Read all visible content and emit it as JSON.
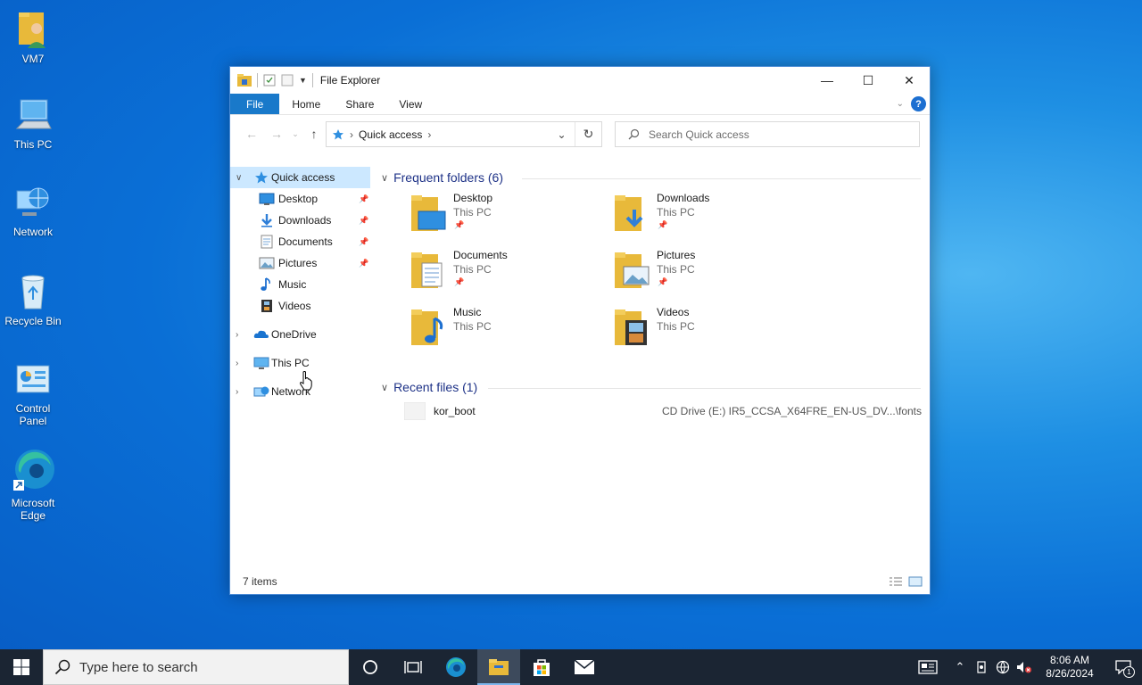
{
  "desktop": {
    "icons": [
      {
        "label": "VM7"
      },
      {
        "label": "This PC"
      },
      {
        "label": "Network"
      },
      {
        "label": "Recycle Bin"
      },
      {
        "label": "Control Panel"
      },
      {
        "label": "Microsoft Edge"
      }
    ]
  },
  "window": {
    "title": "File Explorer",
    "controls": {
      "minimize": "—",
      "maximize": "☐",
      "close": "✕"
    },
    "ribbon": {
      "tabs": [
        "File",
        "Home",
        "Share",
        "View"
      ],
      "help": "?"
    },
    "address": {
      "location": "Quick access"
    },
    "search": {
      "placeholder": "Search Quick access"
    },
    "nav_pane": {
      "quick_access": "Quick access",
      "pinned": [
        {
          "label": "Desktop"
        },
        {
          "label": "Downloads"
        },
        {
          "label": "Documents"
        },
        {
          "label": "Pictures"
        },
        {
          "label": "Music"
        },
        {
          "label": "Videos"
        }
      ],
      "onedrive": "OneDrive",
      "this_pc": "This PC",
      "network": "Network"
    },
    "content": {
      "frequent_header": "Frequent folders (6)",
      "folders": [
        {
          "name": "Desktop",
          "location": "This PC",
          "pinned": true
        },
        {
          "name": "Downloads",
          "location": "This PC",
          "pinned": true
        },
        {
          "name": "Documents",
          "location": "This PC",
          "pinned": true
        },
        {
          "name": "Pictures",
          "location": "This PC",
          "pinned": true
        },
        {
          "name": "Music",
          "location": "This PC",
          "pinned": false
        },
        {
          "name": "Videos",
          "location": "This PC",
          "pinned": false
        }
      ],
      "recent_header": "Recent files (1)",
      "recent_files": [
        {
          "name": "kor_boot",
          "path": "CD Drive (E:) IR5_CCSA_X64FRE_EN-US_DV...\\fonts"
        }
      ]
    },
    "status": {
      "item_count": "7 items"
    }
  },
  "taskbar": {
    "search_placeholder": "Type here to search",
    "clock": {
      "time": "8:06 AM",
      "date": "8/26/2024"
    },
    "notification_count": "1"
  },
  "colors": {
    "accent": "#1979ca",
    "selection": "#cce8ff",
    "taskbar": "#1b2533",
    "group_header": "#1e3287"
  }
}
